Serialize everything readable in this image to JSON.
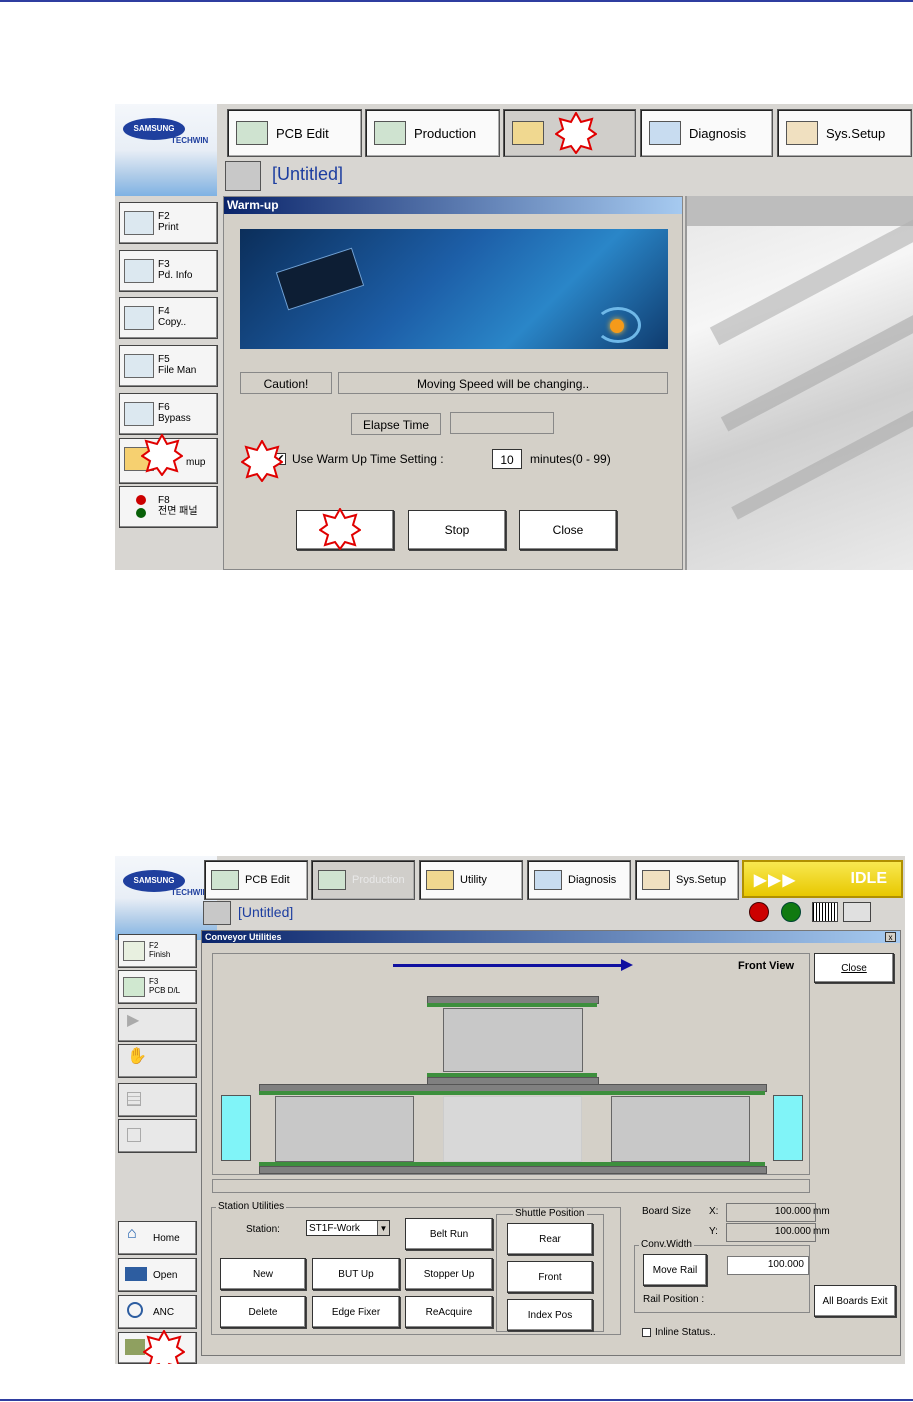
{
  "screen1": {
    "logo": {
      "brand": "SAMSUNG",
      "sub": "TECHWIN"
    },
    "tabs": [
      {
        "label": "PCB Edit",
        "icon": "pcb-edit-icon"
      },
      {
        "label": "Production",
        "icon": "production-icon"
      },
      {
        "label": "",
        "icon": "utility-icon"
      },
      {
        "label": "Diagnosis",
        "icon": "diagnosis-icon"
      },
      {
        "label": "Sys.Setup",
        "icon": "sys-setup-icon"
      }
    ],
    "title": "[Untitled]",
    "side": [
      {
        "key": "F2",
        "label": "Print",
        "icon": "printer-icon"
      },
      {
        "key": "F3",
        "label": "Pd. Info",
        "icon": "pd-info-icon"
      },
      {
        "key": "F4",
        "label": "Copy..",
        "icon": "copy-icon"
      },
      {
        "key": "F5",
        "label": "File Man",
        "icon": "file-manager-icon"
      },
      {
        "key": "F6",
        "label": "Bypass",
        "icon": "bypass-icon"
      },
      {
        "key": "",
        "label": "mup",
        "icon": "warmup-icon"
      },
      {
        "key": "F8",
        "label": "전면 패널",
        "icon": "front-panel-icon"
      }
    ],
    "dialog": {
      "title": "Warm-up",
      "caution": "Caution!",
      "message": "Moving Speed will be changing..",
      "elapse_label": "Elapse Time",
      "elapse_value": "",
      "checkbox_label": "Use Warm Up Time Setting :",
      "checkbox_checked": true,
      "minutes_value": "10",
      "minutes_suffix": "minutes(0 - 99)",
      "btn_start": "",
      "btn_stop": "Stop",
      "btn_close": "Close"
    }
  },
  "screen2": {
    "logo": {
      "brand": "SAMSUNG",
      "sub": "TECHWIN"
    },
    "tabs": [
      {
        "label": "PCB Edit",
        "icon": "pcb-edit-icon"
      },
      {
        "label": "Production",
        "icon": "production-icon"
      },
      {
        "label": "Utility",
        "icon": "utility-icon"
      },
      {
        "label": "Diagnosis",
        "icon": "diagnosis-icon"
      },
      {
        "label": "Sys.Setup",
        "icon": "sys-setup-icon"
      }
    ],
    "status": "IDLE",
    "title": "[Untitled]",
    "side": [
      {
        "key": "F2",
        "label": "Finish",
        "icon": "finish-icon"
      },
      {
        "key": "F3",
        "label": "PCB D/L",
        "icon": "pcb-download-icon"
      }
    ],
    "bottom_side": [
      {
        "label": "Home",
        "icon": "home-icon"
      },
      {
        "label": "Open",
        "icon": "folder-open-icon"
      },
      {
        "label": "ANC",
        "icon": "anc-icon"
      }
    ],
    "dialog": {
      "title": "Conveyor Utilities",
      "close_x": "x",
      "view_label": "Front View",
      "close_btn": "Close",
      "station_group": "Station Utilities",
      "station_label": "Station:",
      "station_value": "ST1F-Work",
      "buttons": [
        "Belt Run",
        "New",
        "BUT Up",
        "Stopper Up",
        "Delete",
        "Edge Fixer",
        "ReAcquire"
      ],
      "shuttle_group": "Shuttle Position",
      "shuttle_buttons": [
        "Rear",
        "Front",
        "Index Pos"
      ],
      "board_size_label": "Board Size",
      "x_label": "X:",
      "x_value": "100.000",
      "y_label": "Y:",
      "y_value": "100.000",
      "unit": "mm",
      "conv_group": "Conv.Width",
      "move_rail": "Move Rail",
      "move_value": "100.000",
      "rail_position": "Rail Position :",
      "all_boards_exit": "All Boards Exit",
      "inline_status": "Inline Status.."
    }
  },
  "colors": {
    "accent_blue": "#0a246a",
    "idle_yellow": "#f2d600",
    "marker_red": "#e00000",
    "rule_blue": "#2f3ea0"
  }
}
